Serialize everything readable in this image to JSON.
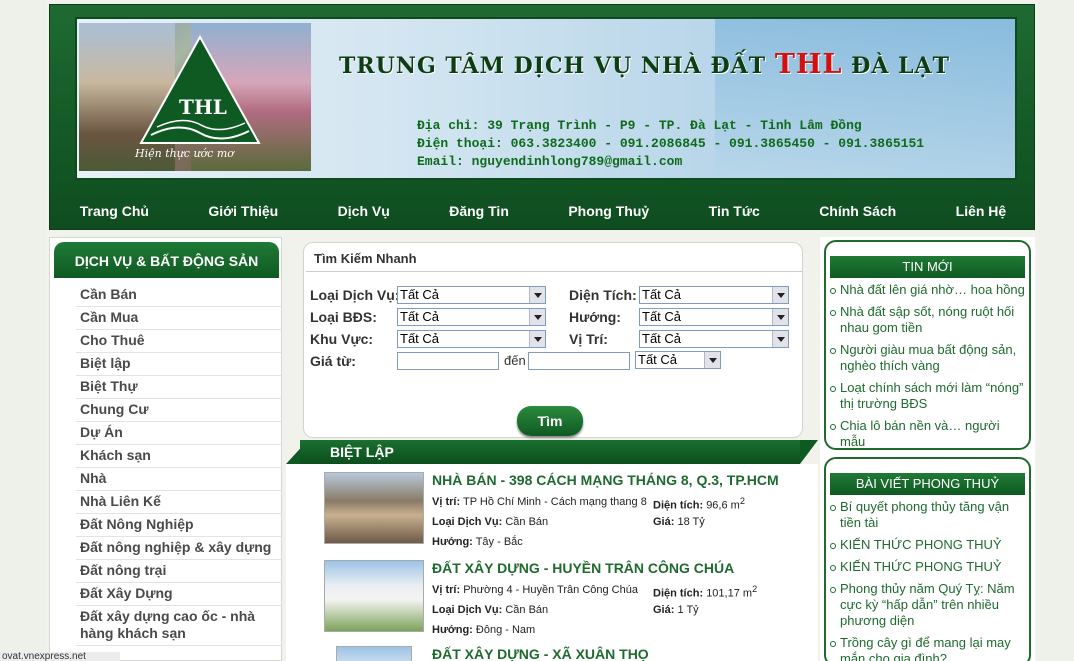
{
  "header": {
    "title_prefix": "TRUNG TÂM DỊCH VỤ NHÀ ĐẤT",
    "title_brand": "THL",
    "title_suffix": "ĐÀ LẠT",
    "logo_text": "THL",
    "slogan": "Hiện thực ước mơ",
    "address": "Địa chỉ: 39 Trạng Trình - P9 - TP. Đà Lạt - Tỉnh Lâm Đồng",
    "phone": "Điện thoại: 063.3823400 - 091.2086845 - 091.3865450 - 091.3865151",
    "email": "Email: nguyendinhlong789@gmail.com"
  },
  "nav": [
    "Trang Chủ",
    "Giới Thiệu",
    "Dịch Vụ",
    "Đăng Tin",
    "Phong Thuỷ",
    "Tin Tức",
    "Chính Sách",
    "Liên Hệ"
  ],
  "left": {
    "heading": "DỊCH VỤ & BẤT ĐỘNG SẢN",
    "items": [
      "Cần Bán",
      "Cần Mua",
      "Cho Thuê",
      "Biệt lập",
      "Biệt Thự",
      "Chung Cư",
      "Dự Án",
      "Khách sạn",
      "Nhà",
      "Nhà Liên Kế",
      "Đất Nông Nghiệp",
      "Đất nông nghiệp & xây dựng",
      "Đất nông trại",
      "Đất Xây Dựng",
      "Đất xây dựng cao ốc - nhà hàng khách sạn"
    ]
  },
  "search": {
    "title": "Tìm Kiếm Nhanh",
    "labels": {
      "loai_dich_vu": "Loại Dịch Vụ:",
      "dien_tich": "Diện Tích:",
      "loai_bds": "Loại BĐS:",
      "huong": "Hướng:",
      "khu_vuc": "Khu Vực:",
      "vi_tri": "Vị Trí:",
      "gia_tu": "Giá từ:",
      "den": "đến"
    },
    "default_option": "Tất Cả",
    "button": "Tìm"
  },
  "section": {
    "title": "BIỆT LẬP"
  },
  "listings": [
    {
      "title": "NHÀ BÁN - 398 CÁCH MẠNG THÁNG 8, Q.3, TP.HCM",
      "vi_tri_label": "Vị trí:",
      "vi_tri": "TP Hồ Chí Minh - Cách mạng thang 8",
      "dien_tich_label": "Diện tích:",
      "dien_tich": "96,6 m",
      "loai_label": "Loại Dịch Vụ:",
      "loai": "Cần Bán",
      "gia_label": "Giá:",
      "gia": "18 Tỷ",
      "huong_label": "Hướng:",
      "huong": "Tây - Bắc"
    },
    {
      "title": "ĐẤT XÂY DỰNG - HUYỀN TRÂN CÔNG CHÚA",
      "vi_tri_label": "Vị trí:",
      "vi_tri": "Phường 4 - Huyền Trân Công Chúa",
      "dien_tich_label": "Diện tích:",
      "dien_tich": "101,17 m",
      "loai_label": "Loại Dịch Vụ:",
      "loai": "Cần Bán",
      "gia_label": "Giá:",
      "gia": "1 Tỷ",
      "huong_label": "Hướng:",
      "huong": "Đông - Nam"
    },
    {
      "title": "ĐẤT XÂY DỰNG - XÃ XUÂN THỌ"
    }
  ],
  "area_unit_sup": "2",
  "news": {
    "heading": "TIN MỚI",
    "items": [
      "Nhà đất lên giá nhờ… hoa hồng",
      "Nhà đất sập sốt, nóng ruột hối nhau gom tiền",
      "Người giàu mua bất động sản, nghèo thích vàng",
      "Loạt chính sách mới làm “nóng” thị trường BĐS",
      "Chia lô bán nền và… người mẫu"
    ]
  },
  "fengshui": {
    "heading": "BÀI VIẾT PHONG THUỶ",
    "items": [
      "Bí quyết phong thủy tăng vận tiền tài",
      "KIẾN THỨC PHONG THUỶ",
      "KIẾN THỨC PHONG THUỶ",
      "Phong thủy năm Quý Tỵ: Năm cực kỳ “hấp dẫn” trên nhiều phương diện",
      "Trồng cây gì để mang lại may mắn cho gia đình?"
    ]
  },
  "status": "ovat.vnexpress.net"
}
